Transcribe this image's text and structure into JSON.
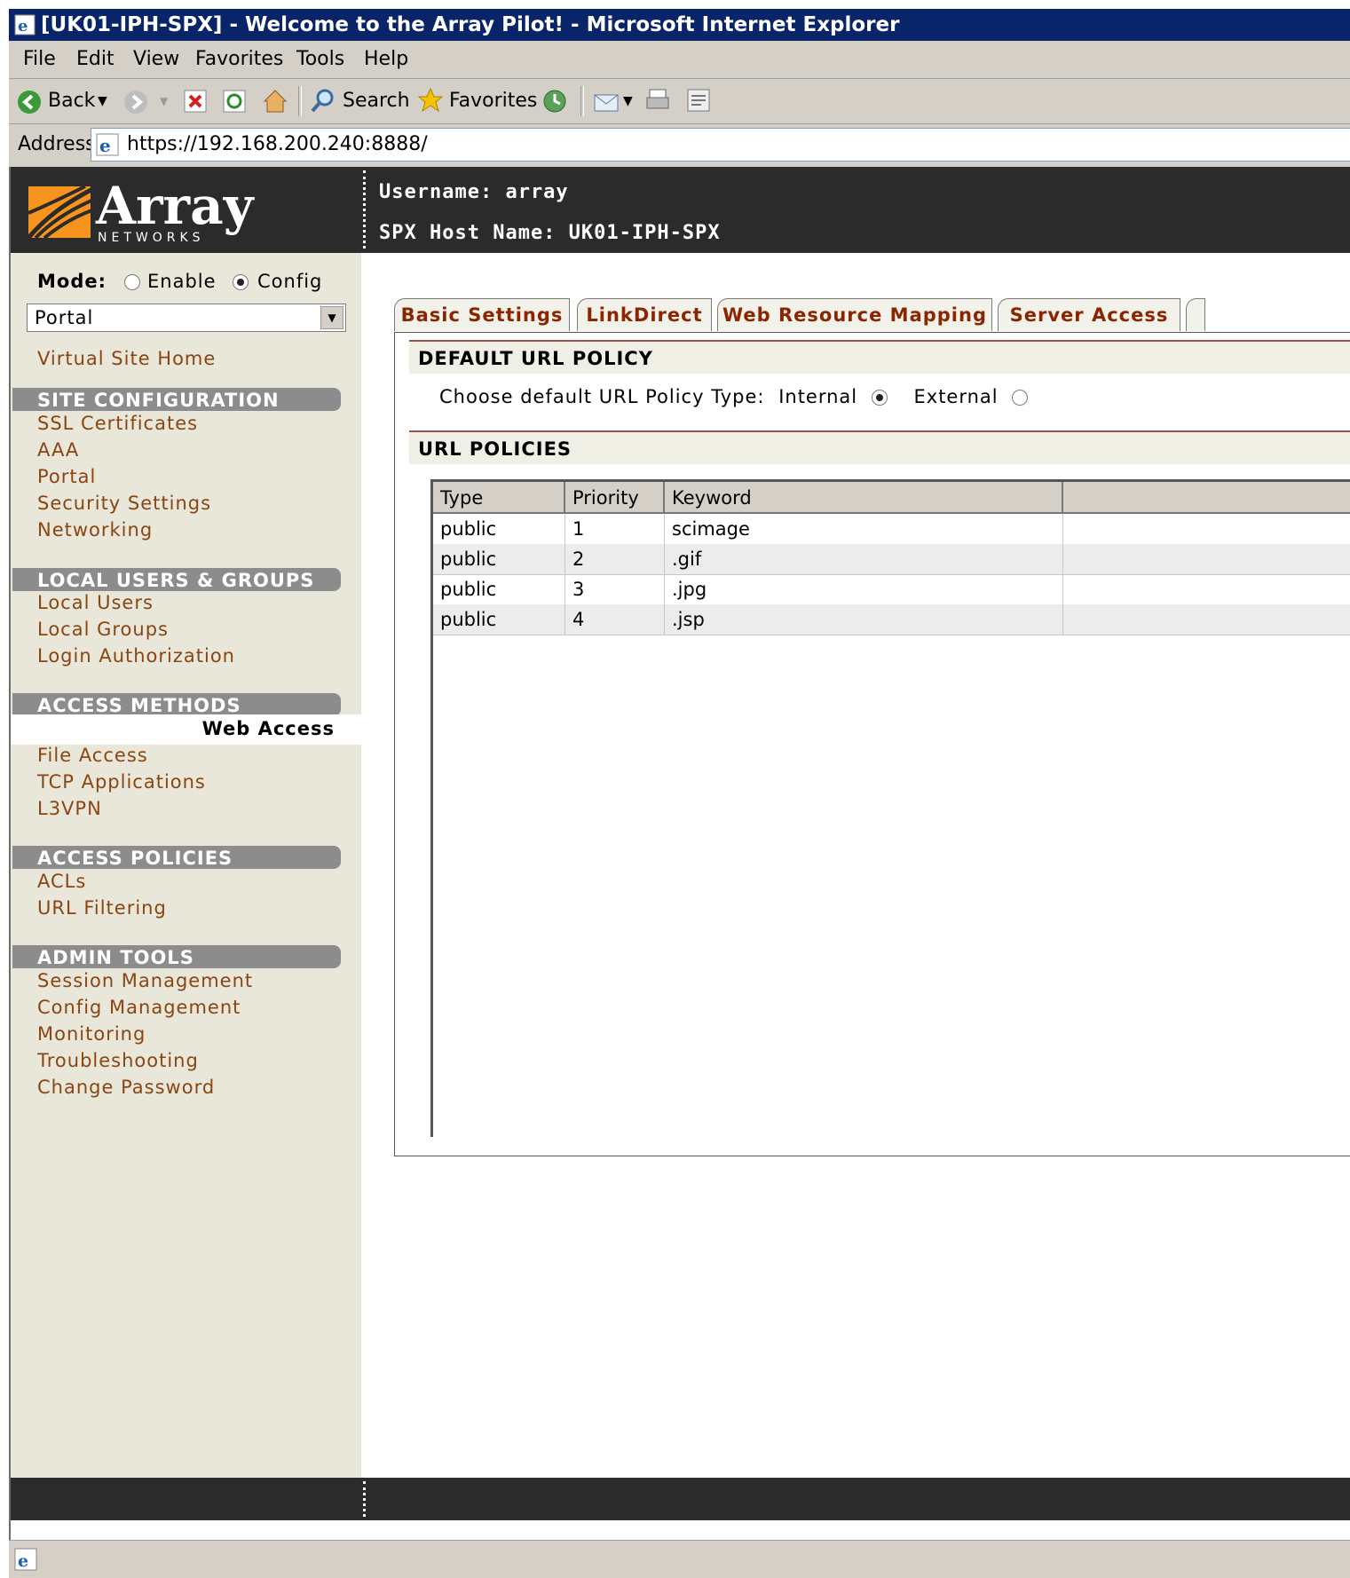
{
  "window": {
    "title": "[UK01-IPH-SPX] - Welcome to the Array Pilot! - Microsoft Internet Explorer"
  },
  "menu": [
    "File",
    "Edit",
    "View",
    "Favorites",
    "Tools",
    "Help"
  ],
  "toolbar": {
    "back_label": "Back",
    "search_label": "Search",
    "favorites_label": "Favorites"
  },
  "address": {
    "label": "Address",
    "url": "https://192.168.200.240:8888/"
  },
  "header": {
    "logo_text": "Array",
    "logo_sub": "NETWORKS",
    "username": "Username: array",
    "host": "SPX Host Name: UK01-IPH-SPX"
  },
  "sidebar": {
    "mode_label": "Mode:",
    "mode_options": [
      "Enable",
      "Config"
    ],
    "mode_selected": "Config",
    "select_value": "Portal",
    "home": "Virtual Site Home",
    "sections": [
      {
        "title": "SITE CONFIGURATION",
        "items": [
          "SSL Certificates",
          "AAA",
          "Portal",
          "Security Settings",
          "Networking"
        ]
      },
      {
        "title": "LOCAL USERS & GROUPS",
        "items": [
          "Local Users",
          "Local Groups",
          "Login Authorization"
        ]
      },
      {
        "title": "ACCESS METHODS",
        "items": [
          "Web Access",
          "File Access",
          "TCP Applications",
          "L3VPN"
        ]
      },
      {
        "title": "ACCESS POLICIES",
        "items": [
          "ACLs",
          "URL Filtering"
        ]
      },
      {
        "title": "ADMIN TOOLS",
        "items": [
          "Session Management",
          "Config Management",
          "Monitoring",
          "Troubleshooting",
          "Change Password"
        ]
      }
    ],
    "active_item": "Web Access"
  },
  "tabs": [
    "Basic Settings",
    "LinkDirect",
    "Web Resource Mapping",
    "Server Access"
  ],
  "default_policy": {
    "title": "DEFAULT URL POLICY",
    "prompt": "Choose default URL Policy Type:",
    "options": [
      "Internal",
      "External"
    ],
    "selected": "Internal"
  },
  "url_policies": {
    "title": "URL POLICIES",
    "columns": [
      "Type",
      "Priority",
      "Keyword"
    ],
    "rows": [
      [
        "public",
        "1",
        "scimage"
      ],
      [
        "public",
        "2",
        ".gif"
      ],
      [
        "public",
        "3",
        ".jpg"
      ],
      [
        "public",
        "4",
        ".jsp"
      ]
    ]
  },
  "colors": {
    "header_bg": "#2b2b2b",
    "sidebar_bg": "#e8e7d9",
    "link": "#8b4513",
    "tab_text": "#8b2500",
    "logo_orange": "#f7941d"
  }
}
